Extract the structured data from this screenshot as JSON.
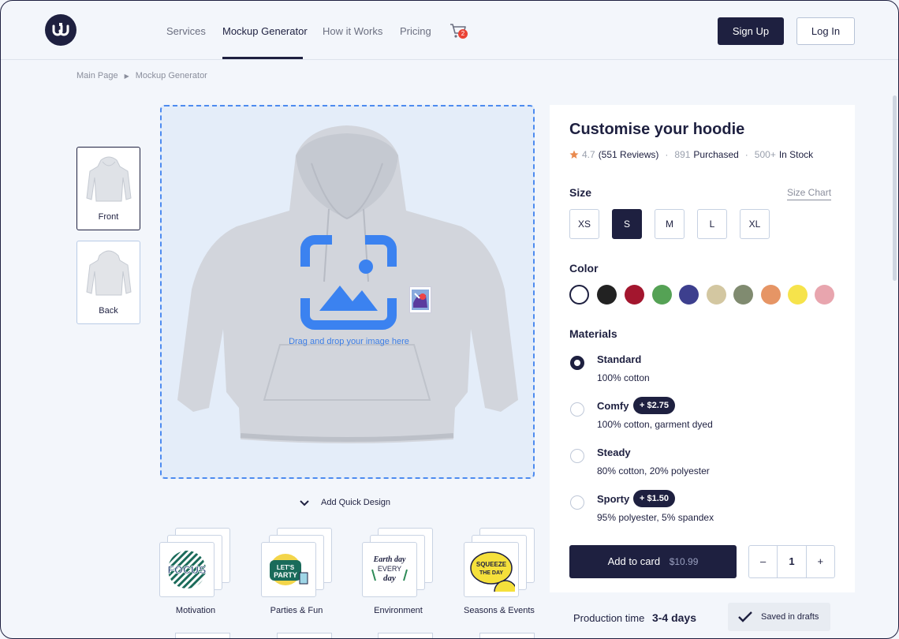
{
  "header": {
    "nav": [
      {
        "label": "Services"
      },
      {
        "label": "Mockup Generator"
      },
      {
        "label": "How it Works"
      },
      {
        "label": "Pricing"
      }
    ],
    "cart_count": "2",
    "signup_label": "Sign Up",
    "login_label": "Log In"
  },
  "breadcrumb": [
    "Main Page",
    "Mockup Generator"
  ],
  "views": [
    {
      "label": "Front"
    },
    {
      "label": "Back"
    }
  ],
  "canvas": {
    "drop_text": "Drag and drop your image here"
  },
  "quick_design_label": "Add Quick Design",
  "designs": [
    {
      "label": "Motivation",
      "art_text": "FOCUS"
    },
    {
      "label": "Parties & Fun",
      "art_text": "LET'S PARTY"
    },
    {
      "label": "Environment",
      "art_text": "Earth day EVERY day"
    },
    {
      "label": "Seasons & Events",
      "art_text": "SQUEEZE THE DAY"
    }
  ],
  "product": {
    "title": "Customise your hoodie",
    "rating": "4.7",
    "reviews": "(551 Reviews)",
    "purchased_count": "891",
    "purchased_label": "Purchased",
    "stock_count": "500+",
    "stock_label": "In Stock",
    "size_label": "Size",
    "size_chart_label": "Size Chart",
    "sizes": [
      "XS",
      "S",
      "M",
      "L",
      "XL"
    ],
    "selected_size": "S",
    "color_label": "Color",
    "colors": [
      "#ffffff",
      "#222222",
      "#a3162e",
      "#55a255",
      "#3d3f8e",
      "#d3c7a1",
      "#808b70",
      "#e69565",
      "#f6e34b",
      "#e8a5ae"
    ],
    "selected_color": "#ffffff",
    "materials_label": "Materials",
    "materials": [
      {
        "name": "Standard",
        "desc": "100% cotton",
        "price": ""
      },
      {
        "name": "Comfy",
        "desc": "100% cotton, garment dyed",
        "price": "+ $2.75"
      },
      {
        "name": "Steady",
        "desc": "80% cotton, 20% polyester",
        "price": ""
      },
      {
        "name": "Sporty",
        "desc": "95% polyester, 5% spandex",
        "price": "+ $1.50"
      }
    ],
    "selected_material": "Standard",
    "add_label": "Add to card",
    "add_price": "$10.99",
    "qty_minus": "–",
    "quantity": "1",
    "qty_plus": "+"
  },
  "footer": {
    "production_label": "Production time",
    "production_value": "3-4 days",
    "saved_label": "Saved in drafts"
  }
}
